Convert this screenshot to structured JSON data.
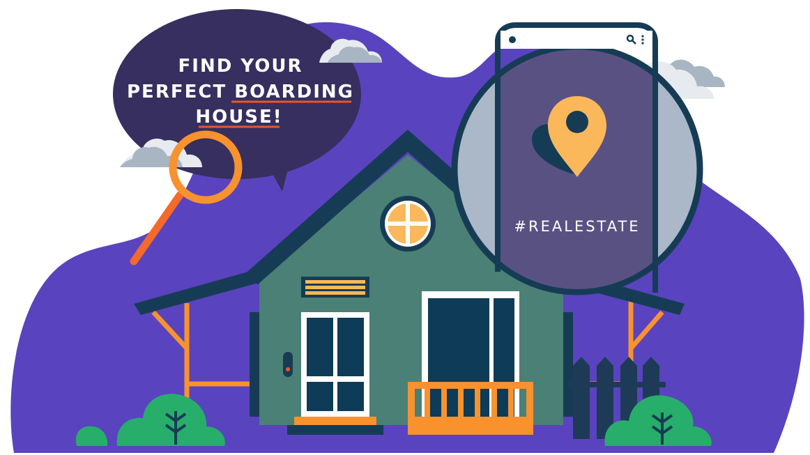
{
  "headline": {
    "line1": "FIND YOUR",
    "line2_prefix": "PERFECT",
    "line2_highlight": "BOARDING",
    "line3": "HOUSE!"
  },
  "phone": {
    "hashtag": "#REALESTATE",
    "status_icons": [
      "dot-icon",
      "search-icon",
      "more-vertical-icon"
    ]
  },
  "colors": {
    "background_blob": "#5a43bf",
    "speech_bubble": "#372f5f",
    "house_wall": "#4a8076",
    "roof_trim": "#163c55",
    "window_glass": "#0d3b58",
    "accent_orange": "#f7922e",
    "magnifier": "#f36a2a",
    "window_yellow": "#fbb85a",
    "lens_circle": "#aab8c8",
    "phone_screen": "#5a5183",
    "bush_green": "#27ae6a",
    "underline_red": "#e8562a",
    "cloud_white": "#e7ebef",
    "cloud_grey": "#a8b5c3"
  }
}
